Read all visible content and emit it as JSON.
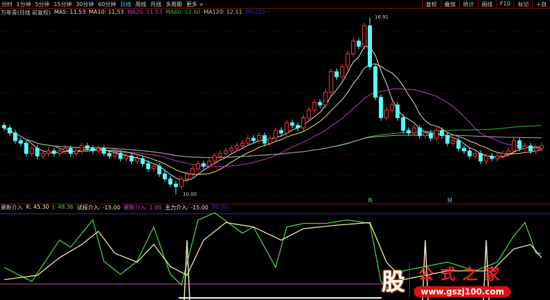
{
  "toolbar": {
    "periods": [
      "分时",
      "1分钟",
      "5分钟",
      "15分钟",
      "30分钟",
      "60分钟",
      "日线",
      "周线",
      "月线",
      "多周期",
      "更多 >"
    ],
    "active": "日线",
    "right_buttons": [
      "复权",
      "叠加",
      "统计",
      "画线",
      "F10",
      "标记",
      "+自"
    ]
  },
  "legend": {
    "title": "万年青(日线 前复权)",
    "ma5": "MA5: 11.53",
    "ma10": "MA10: 11.53",
    "ma20": "MA20: 11.53",
    "ma60": "MA60: 12.60",
    "ma120": "MA120: 12.11",
    "ma250": "MA250: -"
  },
  "indicator_legend": {
    "name": "果断介入",
    "k": "K: 45.30",
    "j": "J: 48.36",
    "probe": "试探介入: -15.00",
    "decisive": "果断介入: 1.00",
    "main": "主力介入: -15.00",
    "extra": "80.00"
  },
  "price_labels": {
    "high": "16.91",
    "low": "10.00"
  },
  "markers": {
    "m1": "跌",
    "m2": "财"
  },
  "watermark": {
    "char": "股",
    "name": "公式之家",
    "url": "www.gszj100.com"
  },
  "colors": {
    "up": "#ff3c3c",
    "down": "#54ffff",
    "ma5": "#e8e8e8",
    "ma10": "#f0e68c",
    "ma20": "#c040c0",
    "ma60": "#40b040",
    "ma120": "#aaaaaa",
    "k": "#f5f0a0",
    "j": "#50d040",
    "probe": "#f5e6c0",
    "line_pink": "#d040d0",
    "line_blue": "#3030c0"
  },
  "chart_data": {
    "type": "candlestick",
    "price_range": [
      10.0,
      16.91
    ],
    "closes": [
      12.6,
      12.4,
      12.1,
      12.0,
      11.6,
      11.8,
      11.5,
      11.6,
      11.7,
      11.6,
      11.7,
      11.8,
      11.6,
      11.7,
      11.9,
      11.8,
      11.7,
      11.8,
      11.6,
      11.5,
      11.6,
      11.4,
      11.5,
      11.3,
      11.4,
      11.2,
      11.0,
      11.1,
      10.8,
      10.6,
      10.4,
      10.3,
      10.6,
      10.8,
      11.0,
      11.2,
      11.1,
      11.3,
      11.5,
      11.6,
      11.7,
      11.8,
      11.9,
      12.0,
      12.2,
      12.1,
      12.3,
      12.0,
      12.2,
      12.5,
      12.4,
      12.8,
      12.7,
      12.6,
      13.0,
      13.3,
      13.6,
      13.5,
      14.0,
      14.8,
      14.6,
      15.0,
      15.5,
      16.0,
      15.8,
      16.6,
      15.0,
      13.8,
      13.0,
      13.3,
      13.5,
      13.0,
      12.5,
      12.4,
      12.6,
      12.3,
      12.4,
      12.2,
      12.5,
      12.3,
      12.0,
      12.1,
      11.8,
      11.7,
      11.5,
      11.6,
      11.3,
      11.5,
      11.4,
      11.5,
      11.6,
      11.7,
      12.1,
      11.8,
      11.9,
      11.7,
      11.8,
      11.9
    ],
    "indicator": {
      "range": [
        0,
        100
      ],
      "J": [
        [
          0,
          34
        ],
        [
          5,
          18
        ],
        [
          10,
          65
        ],
        [
          12,
          57
        ],
        [
          16,
          88
        ],
        [
          18,
          41
        ],
        [
          21,
          26
        ],
        [
          24,
          41
        ],
        [
          27,
          80
        ],
        [
          30,
          26
        ],
        [
          32,
          14
        ],
        [
          35,
          88
        ],
        [
          38,
          96
        ],
        [
          43,
          73
        ],
        [
          45,
          80
        ],
        [
          49,
          34
        ],
        [
          51,
          80
        ],
        [
          54,
          84
        ],
        [
          58,
          84
        ],
        [
          62,
          88
        ],
        [
          66,
          84
        ],
        [
          68,
          18
        ],
        [
          70,
          5
        ],
        [
          72,
          30
        ],
        [
          80,
          40
        ],
        [
          85,
          30
        ],
        [
          89,
          40
        ],
        [
          92,
          70
        ],
        [
          94,
          85
        ],
        [
          96,
          50
        ],
        [
          97,
          50
        ]
      ],
      "K": [
        [
          0,
          20
        ],
        [
          6,
          25
        ],
        [
          10,
          45
        ],
        [
          14,
          60
        ],
        [
          17,
          75
        ],
        [
          20,
          50
        ],
        [
          24,
          40
        ],
        [
          27,
          60
        ],
        [
          30,
          35
        ],
        [
          33,
          25
        ],
        [
          36,
          65
        ],
        [
          40,
          85
        ],
        [
          45,
          80
        ],
        [
          50,
          65
        ],
        [
          54,
          78
        ],
        [
          60,
          82
        ],
        [
          66,
          85
        ],
        [
          69,
          40
        ],
        [
          72,
          20
        ],
        [
          80,
          30
        ],
        [
          88,
          30
        ],
        [
          92,
          55
        ],
        [
          95,
          60
        ],
        [
          97,
          45
        ]
      ],
      "probe_spikes": [
        33,
        76,
        87
      ],
      "probe_level": 65,
      "pink_level": 15,
      "blue_level": 95
    }
  }
}
